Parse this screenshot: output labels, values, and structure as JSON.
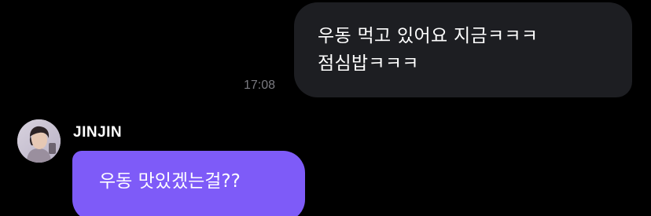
{
  "conversation": {
    "outgoing": {
      "line1": "우동 먹고 있어요 지금ㅋㅋㅋ",
      "line2": "점심밥ㅋㅋㅋ",
      "time": "17:08"
    },
    "incoming": {
      "sender": "JINJIN",
      "text": "우동 맛있겠는걸??",
      "avatar_icon": "profile-photo-avatar"
    }
  },
  "colors": {
    "background": "#000000",
    "outgoing_bubble": "#1d1e22",
    "incoming_bubble": "#7e5bf8",
    "timestamp": "#7a7a80"
  }
}
